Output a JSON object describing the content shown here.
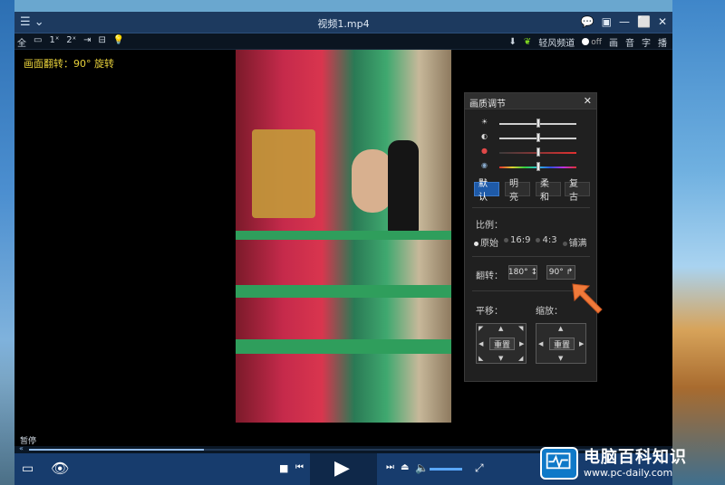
{
  "window": {
    "title": "视频1.mp4"
  },
  "titlebar": {
    "menu_icon": "☰ ⌄",
    "controls": [
      "💬",
      "▣",
      "—",
      "⬜",
      "✕"
    ]
  },
  "toolbar": {
    "left": [
      "全",
      "▭",
      "1ˣ",
      "2ˣ",
      "⇥",
      "⊟",
      "💡"
    ],
    "right_download": "⬇",
    "channel_label": "轻风频道",
    "channel_state": "off",
    "right_tabs": [
      "画",
      "音",
      "字",
      "播"
    ]
  },
  "osd_text": "画面翻转：90° 旋转",
  "status_text": "暂停",
  "progress": {
    "fraction": 0.28
  },
  "panel": {
    "title": "画质调节",
    "sliders": [
      {
        "icon": "☀",
        "value": 0.5
      },
      {
        "icon": "◐",
        "value": 0.5
      },
      {
        "icon": "●",
        "value": 0.5
      },
      {
        "icon": "◉",
        "value": 0.5
      }
    ],
    "presets": [
      "默认",
      "明亮",
      "柔和",
      "复古"
    ],
    "ratio_label": "比例：",
    "ratios": [
      "原始",
      "16:9",
      "4:3",
      "铺满"
    ],
    "flip_label": "翻转：",
    "flip_buttons": [
      {
        "label": "180°",
        "icon": "↕"
      },
      {
        "label": "90°",
        "icon": "↱"
      }
    ],
    "pan_label": "平移：",
    "zoom_label": "缩放：",
    "reset_label": "重置"
  },
  "watermark": {
    "title": "电脑百科知识",
    "url": "www.pc-daily.com"
  }
}
